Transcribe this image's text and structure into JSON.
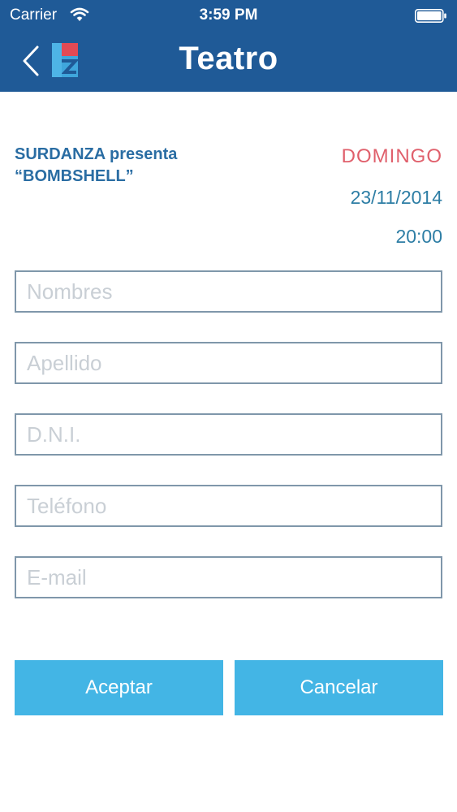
{
  "status_bar": {
    "carrier": "Carrier",
    "time": "3:59 PM",
    "icons": [
      "wifi-icon",
      "battery-icon"
    ]
  },
  "nav": {
    "title": "Teatro",
    "back_icon": "chevron-left-icon",
    "logo_icon": "app-logo-icon"
  },
  "event": {
    "title_line1": "SURDANZA presenta",
    "title_line2": "“BOMBSHELL”",
    "day": "DOMINGO",
    "date": "23/11/2014",
    "time": "20:00"
  },
  "form": {
    "nombres_placeholder": "Nombres",
    "apellido_placeholder": "Apellido",
    "dni_placeholder": "D.N.I.",
    "telefono_placeholder": "Teléfono",
    "email_placeholder": "E-mail"
  },
  "buttons": {
    "accept": "Aceptar",
    "cancel": "Cancelar"
  },
  "colors": {
    "nav_background": "#1f5a97",
    "event_title": "#2a6da3",
    "day": "#e0606c",
    "date_time": "#2e7ea5",
    "field_border": "#7f97aa",
    "button": "#43b5e5"
  }
}
